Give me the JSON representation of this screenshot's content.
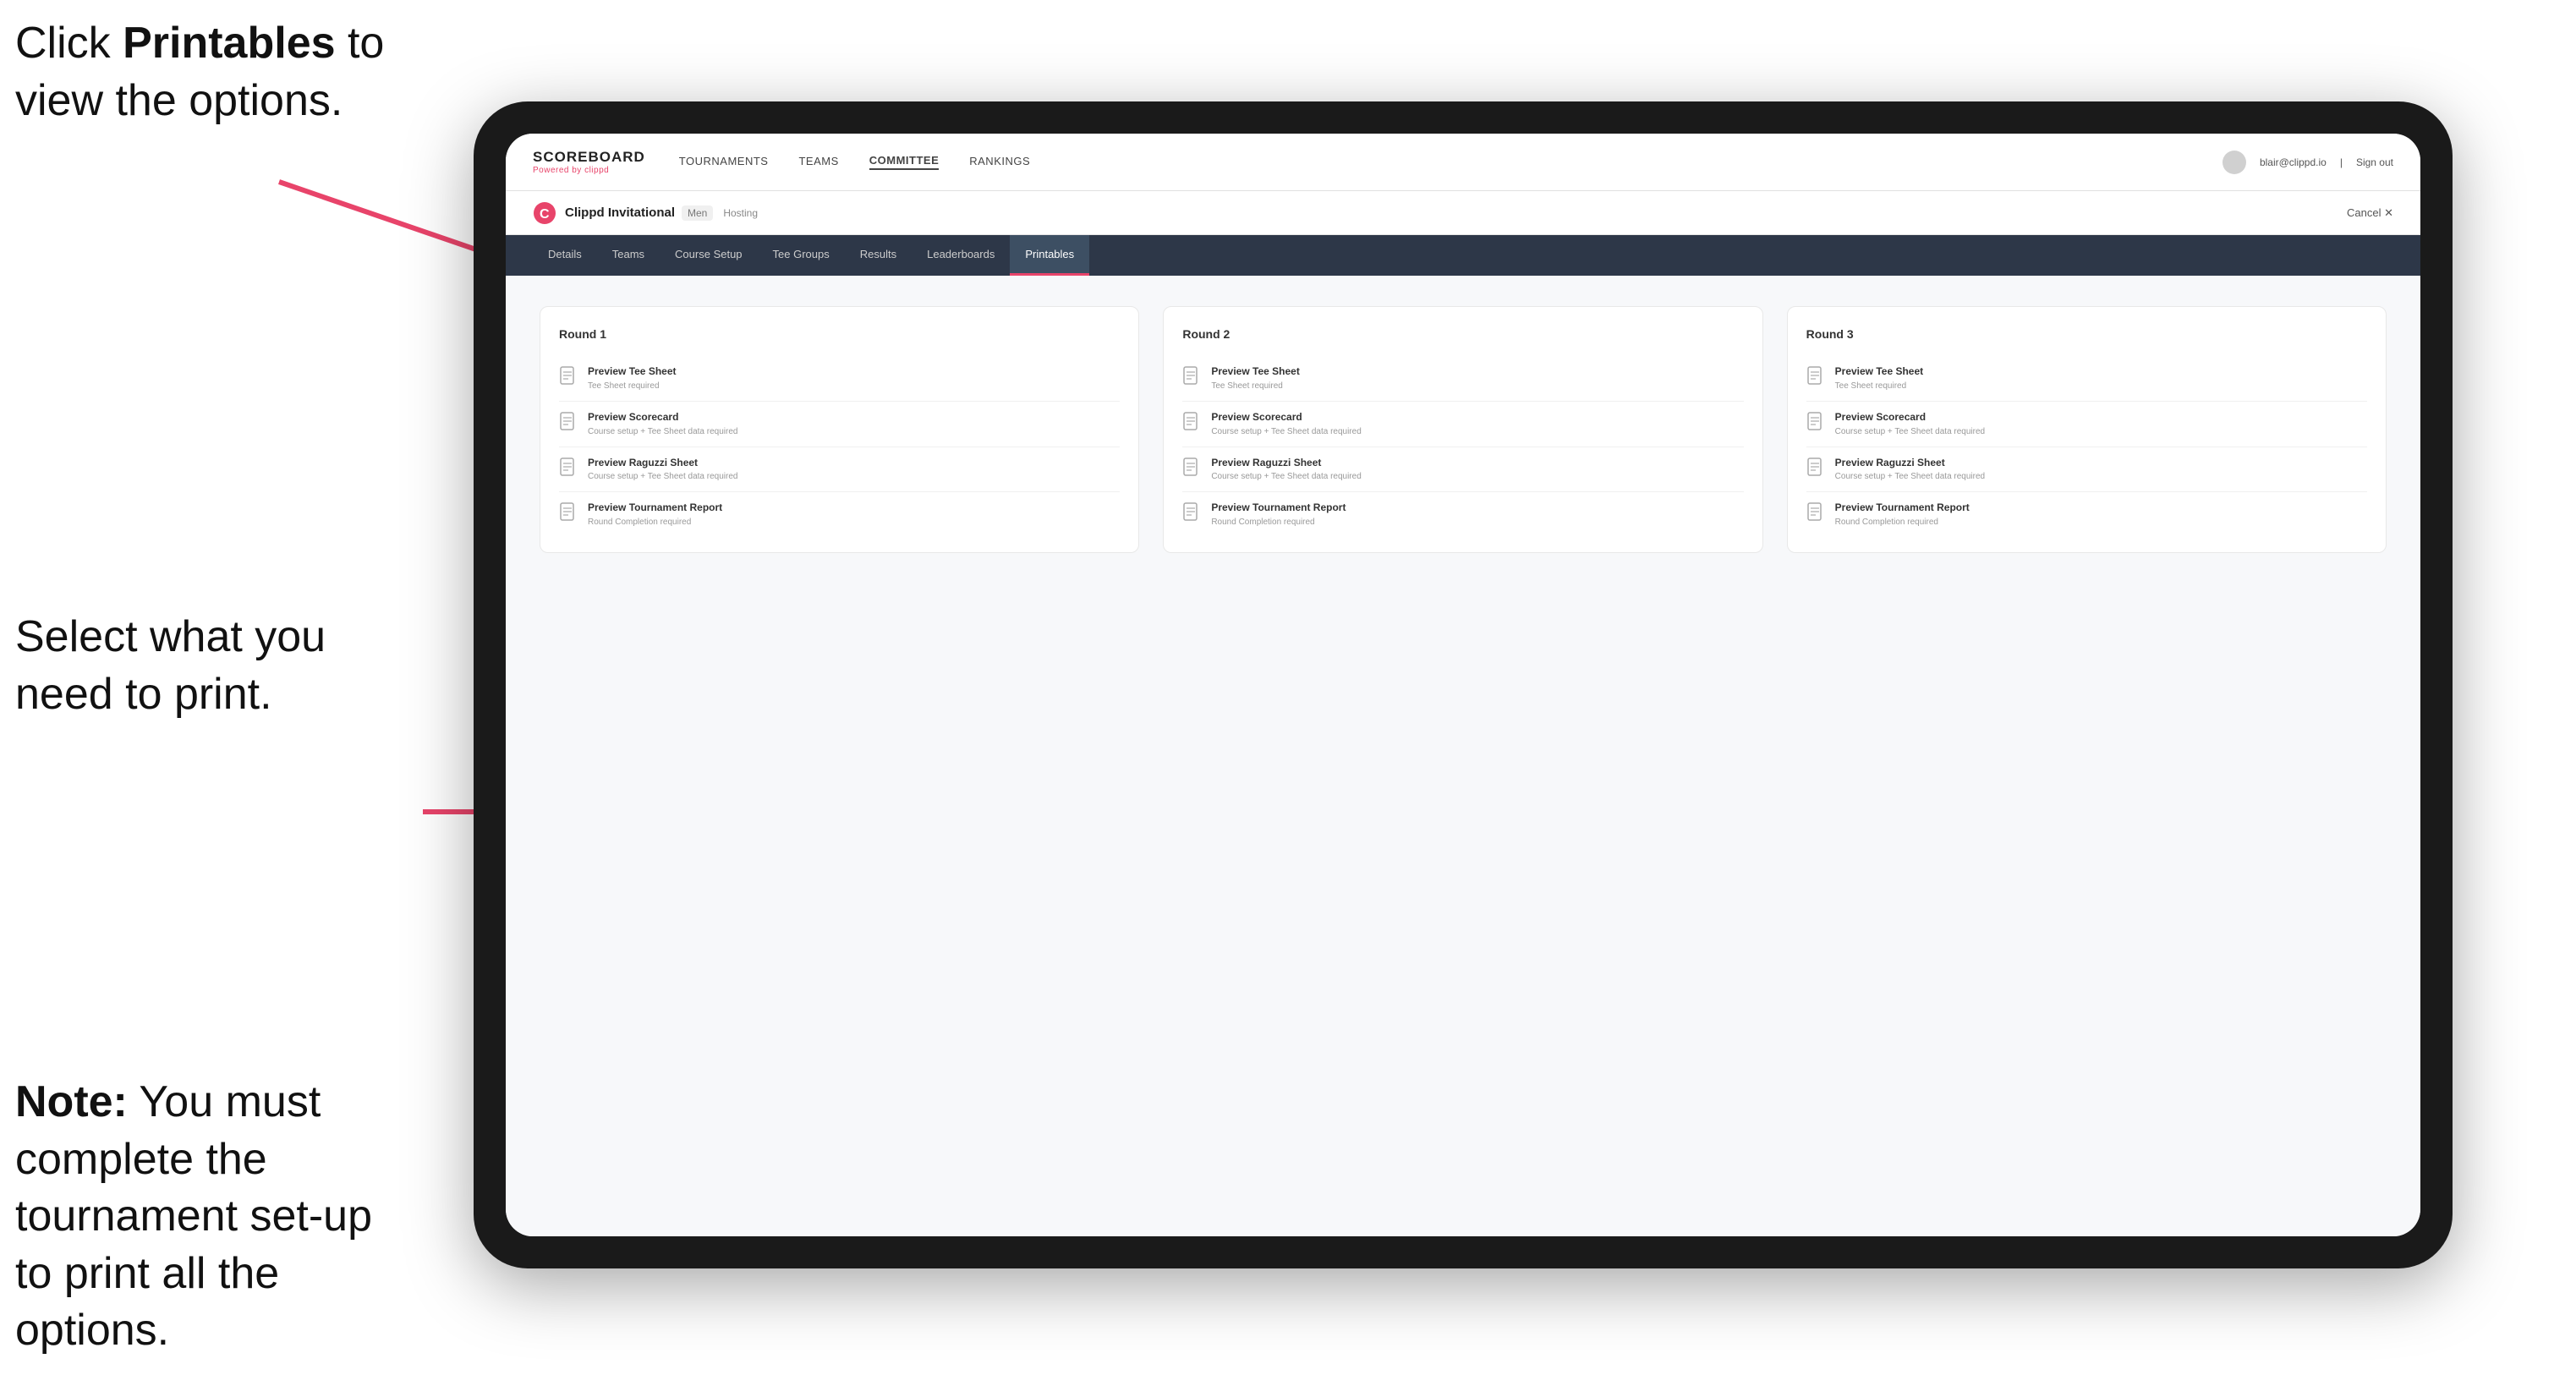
{
  "annotations": {
    "top": {
      "prefix": "Click ",
      "bold": "Printables",
      "suffix": " to\nview the options."
    },
    "mid": "Select what you\nneed to print.",
    "bot": {
      "prefix": "Note:",
      "suffix": " You must\ncomplete the\ntournament set-up\nto print all the options."
    }
  },
  "topnav": {
    "brand": "SCOREBOARD",
    "brand_sub": "Powered by clippd",
    "links": [
      "TOURNAMENTS",
      "TEAMS",
      "COMMITTEE",
      "RANKINGS"
    ],
    "user_email": "blair@clippd.io",
    "sign_out": "Sign out",
    "pipe": "|"
  },
  "tournament": {
    "name": "Clippd Invitational",
    "tag": "Men",
    "badge": "Hosting",
    "cancel": "Cancel  ✕"
  },
  "tabs": [
    {
      "label": "Details",
      "active": false
    },
    {
      "label": "Teams",
      "active": false
    },
    {
      "label": "Course Setup",
      "active": false
    },
    {
      "label": "Tee Groups",
      "active": false
    },
    {
      "label": "Results",
      "active": false
    },
    {
      "label": "Leaderboards",
      "active": false
    },
    {
      "label": "Printables",
      "active": true
    }
  ],
  "rounds": [
    {
      "title": "Round 1",
      "items": [
        {
          "title": "Preview Tee Sheet",
          "sub": "Tee Sheet required"
        },
        {
          "title": "Preview Scorecard",
          "sub": "Course setup + Tee Sheet data required"
        },
        {
          "title": "Preview Raguzzi Sheet",
          "sub": "Course setup + Tee Sheet data required"
        },
        {
          "title": "Preview Tournament Report",
          "sub": "Round Completion required"
        }
      ]
    },
    {
      "title": "Round 2",
      "items": [
        {
          "title": "Preview Tee Sheet",
          "sub": "Tee Sheet required"
        },
        {
          "title": "Preview Scorecard",
          "sub": "Course setup + Tee Sheet data required"
        },
        {
          "title": "Preview Raguzzi Sheet",
          "sub": "Course setup + Tee Sheet data required"
        },
        {
          "title": "Preview Tournament Report",
          "sub": "Round Completion required"
        }
      ]
    },
    {
      "title": "Round 3",
      "items": [
        {
          "title": "Preview Tee Sheet",
          "sub": "Tee Sheet required"
        },
        {
          "title": "Preview Scorecard",
          "sub": "Course setup + Tee Sheet data required"
        },
        {
          "title": "Preview Raguzzi Sheet",
          "sub": "Course setup + Tee Sheet data required"
        },
        {
          "title": "Preview Tournament Report",
          "sub": "Round Completion required"
        }
      ]
    }
  ]
}
